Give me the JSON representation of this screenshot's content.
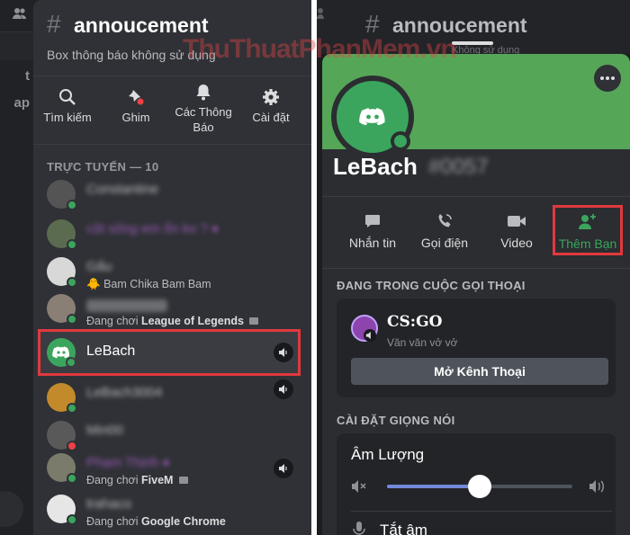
{
  "left": {
    "channel": {
      "hash": "#",
      "name": "annoucement",
      "description": "Box thông báo không sử dụng"
    },
    "toolbar": [
      {
        "label": "Tìm kiếm",
        "icon": "search-icon"
      },
      {
        "label": "Ghim",
        "icon": "pin-icon"
      },
      {
        "label": "Các Thông Báo",
        "icon": "bell-icon"
      },
      {
        "label": "Cài đặt",
        "icon": "gear-icon"
      }
    ],
    "section_title": "TRỰC TUYẾN — 10",
    "members": [
      {
        "name": "Constantine",
        "color": "#b9bbbe",
        "activity": "",
        "game": ""
      },
      {
        "name": "cột sống em ổn ko ? ♦",
        "color": "#9b59b6",
        "activity": "",
        "game": ""
      },
      {
        "name": "Gấu",
        "color": "#b9bbbe",
        "activity": "Bam Chika Bam Bam",
        "game": ""
      },
      {
        "name": "",
        "color": "#b9bbbe",
        "activity": "Đang chơi ",
        "game": "League of Legends"
      },
      {
        "name": "LeBach",
        "color": "#ffffff",
        "activity": "",
        "game": ""
      },
      {
        "name": "LeBach3004",
        "color": "#b9bbbe",
        "activity": "",
        "game": ""
      },
      {
        "name": "Min00",
        "color": "#b9bbbe",
        "activity": "",
        "game": ""
      },
      {
        "name": "Phạm Thịnh ♦",
        "color": "#9b59b6",
        "activity": "Đang chơi ",
        "game": "FiveM"
      },
      {
        "name": "trahaco",
        "color": "#b9bbbe",
        "activity": "Đang chơi ",
        "game": "Google Chrome"
      }
    ]
  },
  "watermark": "ThuThuatPhanMem.vn",
  "right": {
    "top_title": "annoucement",
    "top_hash": "#",
    "top_sub": "Không sử dụng",
    "profile": {
      "name": "LeBach",
      "discriminator": "#0057"
    },
    "actions": [
      {
        "label": "Nhắn tin",
        "icon": "message-icon"
      },
      {
        "label": "Gọi điện",
        "icon": "phone-icon"
      },
      {
        "label": "Video",
        "icon": "video-icon"
      },
      {
        "label": "Thêm Bạn",
        "icon": "add-friend-icon"
      }
    ],
    "call_section": "ĐANG TRONG CUỘC GỌI THOẠI",
    "call": {
      "title": "CS:GO",
      "subtitle": "Văn văn vở vở",
      "button": "Mở Kênh Thoại"
    },
    "voice_section": "CÀI ĐẶT GIỌNG NÓI",
    "volume_label": "Âm Lượng",
    "volume_level": 0.5,
    "mute_label": "Tắt âm"
  },
  "colors": {
    "accent_green": "#3ba55d",
    "highlight_red": "#e0393e",
    "slider_blue": "#7289da"
  }
}
